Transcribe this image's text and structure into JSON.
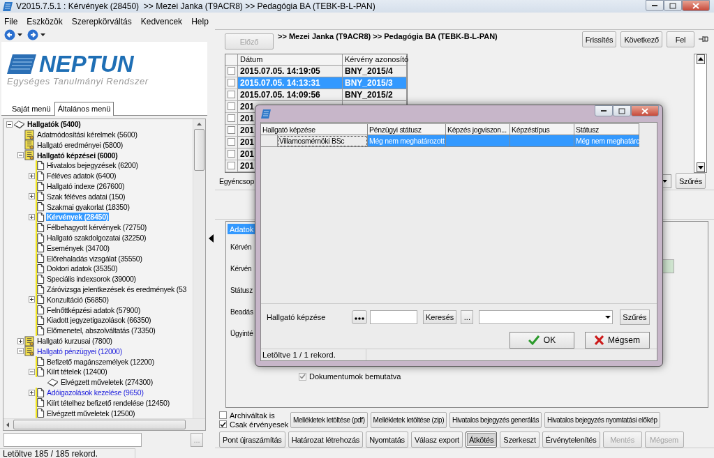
{
  "window": {
    "title": "V2015.7.5.1 : Kérvények (28450)  >> Mezei Janka (T9ACR8) >> Pedagógia BA (TEBK-B-L-PAN)"
  },
  "menu": [
    "File",
    "Eszközök",
    "Szerepkörváltás",
    "Kedvencek",
    "Help"
  ],
  "logo": {
    "name": "NEPTUN",
    "tagline": "Egységes Tanulmányi Rendszer"
  },
  "menu_tabs": [
    {
      "label": "Saját menü",
      "selected": false
    },
    {
      "label": "Általános menü",
      "selected": true
    }
  ],
  "tree": [
    {
      "label": "Hallgatók (5400)",
      "kind": "book",
      "bold": true,
      "blue": false,
      "selected": false,
      "expanded": true,
      "children": [
        {
          "label": "Adatmódosítási kérelmek (5600)",
          "kind": "cert",
          "bold": false,
          "blue": false,
          "selected": false
        },
        {
          "label": "Hallgató eredményei (5800)",
          "kind": "cert",
          "bold": false,
          "blue": false,
          "selected": false
        },
        {
          "label": "Hallgató képzései (6000)",
          "kind": "cert",
          "bold": true,
          "blue": false,
          "selected": false,
          "expanded": true,
          "children": [
            {
              "label": "Hivatalos bejegyzések (6200)",
              "kind": "page",
              "bold": false,
              "blue": false,
              "selected": false
            },
            {
              "label": "Féléves adatok (6400)",
              "kind": "page",
              "bold": false,
              "blue": false,
              "selected": false,
              "expanded": false
            },
            {
              "label": "Hallgató indexe (267600)",
              "kind": "page",
              "bold": false,
              "blue": false,
              "selected": false
            },
            {
              "label": "Szak féléves adatai (150)",
              "kind": "page",
              "bold": false,
              "blue": false,
              "selected": false,
              "expanded": false
            },
            {
              "label": "Szakmai gyakorlat (18350)",
              "kind": "page",
              "bold": false,
              "blue": false,
              "selected": false
            },
            {
              "label": "Kérvények (28450)",
              "kind": "page",
              "bold": true,
              "blue": false,
              "selected": true,
              "expanded": false
            },
            {
              "label": "Félbehagyott kérvények (72750)",
              "kind": "page",
              "bold": false,
              "blue": false,
              "selected": false
            },
            {
              "label": "Hallgató szakdolgozatai (32250)",
              "kind": "page",
              "bold": false,
              "blue": false,
              "selected": false
            },
            {
              "label": "Események (34700)",
              "kind": "page",
              "bold": false,
              "blue": false,
              "selected": false
            },
            {
              "label": "Előrehaladás vizsgálat (35550)",
              "kind": "page",
              "bold": false,
              "blue": false,
              "selected": false
            },
            {
              "label": "Doktori adatok (35350)",
              "kind": "page",
              "bold": false,
              "blue": false,
              "selected": false
            },
            {
              "label": "Speciális indexsorok (39000)",
              "kind": "page",
              "bold": false,
              "blue": false,
              "selected": false
            },
            {
              "label": "Záróvizsga jelentkezések és eredmények (53",
              "kind": "page",
              "bold": false,
              "blue": false,
              "selected": false
            },
            {
              "label": "Konzultáció (56850)",
              "kind": "page",
              "bold": false,
              "blue": false,
              "selected": false,
              "expanded": false
            },
            {
              "label": "Felnőttképzési adatok (57900)",
              "kind": "page",
              "bold": false,
              "blue": false,
              "selected": false
            },
            {
              "label": "Kiadott jegyzetigazolások (66350)",
              "kind": "page",
              "bold": false,
              "blue": false,
              "selected": false
            },
            {
              "label": "Előmenetel, abszolváltatás (73350)",
              "kind": "page",
              "bold": false,
              "blue": false,
              "selected": false
            }
          ]
        },
        {
          "label": "Hallgató kurzusai (7800)",
          "kind": "cert",
          "bold": false,
          "blue": false,
          "selected": false,
          "expanded": false
        },
        {
          "label": "Hallgató pénzügyei (12000)",
          "kind": "cert",
          "bold": false,
          "blue": true,
          "selected": false,
          "expanded": true,
          "children": [
            {
              "label": "Befizető magánszemélyek (12200)",
              "kind": "page",
              "bold": false,
              "blue": false,
              "selected": false
            },
            {
              "label": "Kiírt tételek (12400)",
              "kind": "page",
              "bold": false,
              "blue": false,
              "selected": false,
              "expanded": true,
              "children": [
                {
                  "label": "Elvégzett műveletek (274300)",
                  "kind": "book",
                  "bold": false,
                  "blue": false,
                  "selected": false
                }
              ]
            },
            {
              "label": "Adóigazolások kezelése (9650)",
              "kind": "page",
              "bold": false,
              "blue": true,
              "selected": false,
              "expanded": false
            },
            {
              "label": "Kiírt tételhez befizető rendelése (12450)",
              "kind": "page",
              "bold": false,
              "blue": false,
              "selected": false
            },
            {
              "label": "Elvégzett műveletek (12500)",
              "kind": "page",
              "bold": false,
              "blue": false,
              "selected": false
            }
          ]
        }
      ]
    }
  ],
  "tree_search": {
    "button": "..."
  },
  "left_status": "Letöltve 185 / 185 rekord.",
  "toolbar": {
    "prev": {
      "label": "Előző",
      "disabled": true
    },
    "breadcrumb": ">> Mezei Janka (T9ACR8) >> Pedagógia BA (TEBK-B-L-PAN)",
    "buttons": [
      "Frissítés",
      "Következő",
      "Fel"
    ]
  },
  "grid": {
    "columns": [
      "Dátum",
      "Kérvény azonosító"
    ],
    "rows": [
      {
        "date": "2015.07.05. 14:19:05",
        "id": "BNY_2015/4",
        "selected": false,
        "checked": false
      },
      {
        "date": "2015.07.05. 14:13:31",
        "id": "BNY_2015/3",
        "selected": true,
        "checked": false
      },
      {
        "date": "2015.07.05. 14:09:56",
        "id": "BNY_2015/2",
        "selected": false,
        "checked": false
      },
      {
        "date": "201",
        "selected": false,
        "checked": false
      },
      {
        "date": "201",
        "selected": false,
        "checked": false
      },
      {
        "date": "201",
        "selected": false,
        "checked": false
      },
      {
        "date": "201",
        "selected": false,
        "checked": false
      },
      {
        "date": "201",
        "selected": false,
        "checked": false
      },
      {
        "date": "201",
        "selected": false,
        "checked": false
      }
    ]
  },
  "filter": {
    "label": "Egyéncsop",
    "button": "Szűrés"
  },
  "detail": {
    "tabs": [
      {
        "label": "Adatok",
        "selected": true
      }
    ],
    "labels": [
      "Kérvén",
      "Kérvén",
      "Státusz",
      "Beadás",
      "Ügyinté"
    ],
    "checkbox": {
      "label": "Dokumentumok bemutatva",
      "checked": true,
      "disabled": true
    }
  },
  "options": [
    {
      "label": "Archiváltak is",
      "checked": false
    },
    {
      "label": "Csak érvényesek",
      "checked": true
    }
  ],
  "actions_row1": [
    {
      "label": "Mellékletek letöltése (pdf)",
      "disabled": false,
      "pressed": false
    },
    {
      "label": "Mellékletek letöltése (zip)",
      "disabled": false,
      "pressed": false
    },
    {
      "label": "Hivatalos bejegyzés generálás",
      "disabled": false,
      "pressed": false
    },
    {
      "label": "Hivatalos bejegyzés nyomtatási előkép",
      "disabled": false,
      "pressed": false
    }
  ],
  "actions_row2": [
    {
      "label": "Pont újraszámítás",
      "disabled": false,
      "pressed": false
    },
    {
      "label": "Határozat létrehozás",
      "disabled": false,
      "pressed": false
    },
    {
      "label": "Nyomtatás",
      "disabled": false,
      "pressed": false
    },
    {
      "label": "Válasz export",
      "disabled": false,
      "pressed": false
    },
    {
      "label": "Átkötés",
      "disabled": false,
      "pressed": true
    },
    {
      "label": "Szerkeszt",
      "disabled": false,
      "pressed": false
    },
    {
      "label": "Érvénytelenítés",
      "disabled": false,
      "pressed": false
    },
    {
      "label": "Mentés",
      "disabled": true,
      "pressed": false
    },
    {
      "label": "Mégsem",
      "disabled": true,
      "pressed": false
    }
  ],
  "dialog": {
    "columns": [
      "Hallgató képzése",
      "Pénzügyi státusz",
      "Képzés jogviszon...",
      "Képzéstípus",
      "Státusz"
    ],
    "rows": [
      {
        "cells": [
          "Villamosmérnöki BSc",
          "Még nem meghatározott",
          "",
          "",
          "Még nem meghatárc"
        ],
        "selected": true
      }
    ],
    "filter": {
      "label": "Hallgató képzése",
      "ellipsis": "...",
      "search": "Keresés",
      "filter": "Szűrés"
    },
    "buttons": [
      {
        "kind": "ok",
        "label": "OK"
      },
      {
        "kind": "cancel",
        "label": "Mégsem"
      }
    ],
    "status": "Letöltve 1 / 1 rekord."
  }
}
